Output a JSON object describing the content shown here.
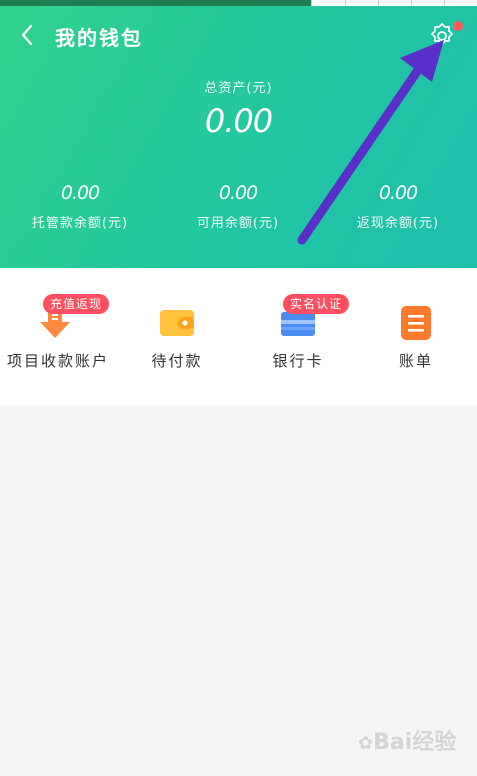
{
  "header": {
    "title": "我的钱包",
    "total_label": "总资产(元)",
    "total_value": "0.00",
    "stats": [
      {
        "value": "0.00",
        "label": "托管款余额(元)"
      },
      {
        "value": "0.00",
        "label": "可用余额(元)"
      },
      {
        "value": "0.00",
        "label": "返现余额(元)"
      }
    ]
  },
  "menu": {
    "items": [
      {
        "label": "项目收款账户",
        "badge": "充值返现",
        "icon": "download-arrow-icon"
      },
      {
        "label": "待付款",
        "icon": "wallet-icon"
      },
      {
        "label": "银行卡",
        "badge": "实名认证",
        "icon": "bank-card-icon"
      },
      {
        "label": "账单",
        "icon": "bill-icon"
      }
    ]
  },
  "watermark": {
    "text": "Bai经验"
  },
  "colors": {
    "header_start": "#2fd28c",
    "header_end": "#1fbfae",
    "badge": "#ff4f60",
    "arrow": "#5a2fc9",
    "notification_dot": "#ff5a5a"
  },
  "icons": {
    "back": "back-chevron-icon",
    "settings": "gear-icon"
  }
}
